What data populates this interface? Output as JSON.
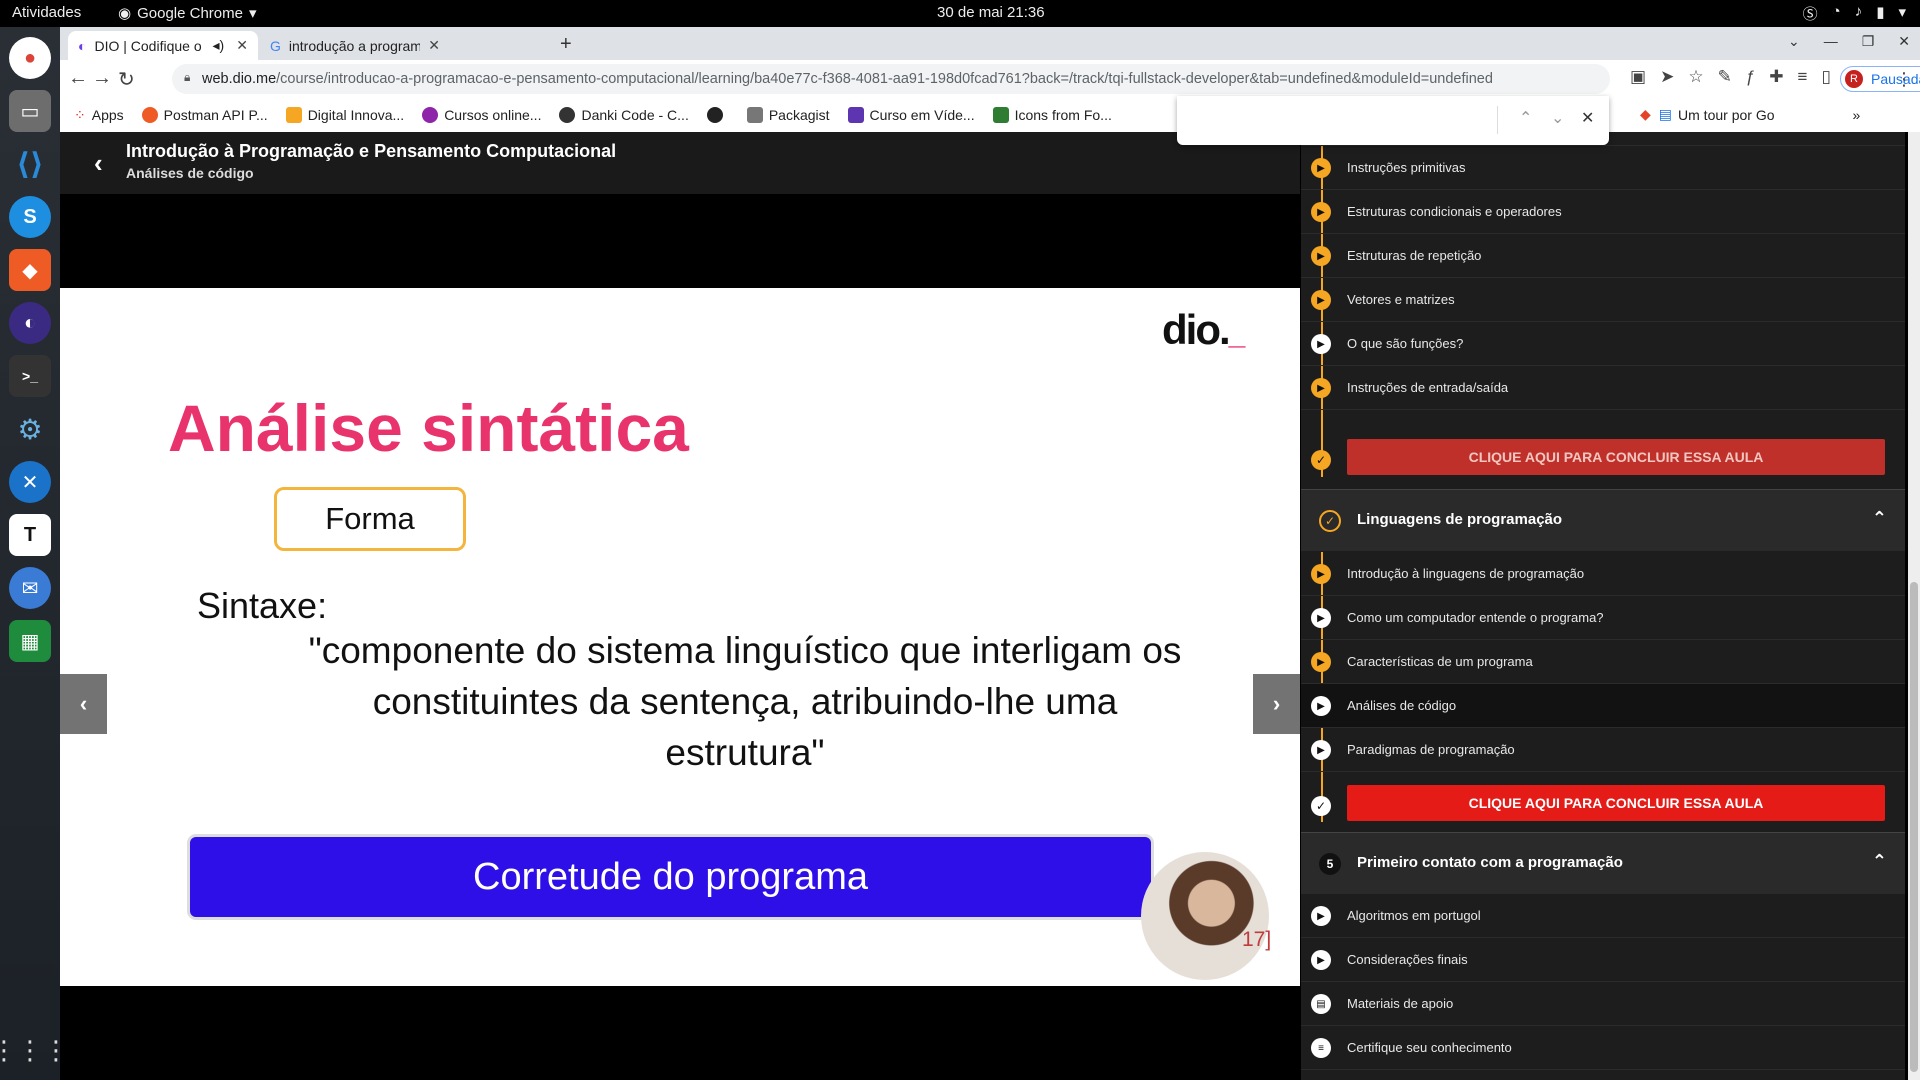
{
  "topbar": {
    "activities": "Atividades",
    "app": "Google Chrome",
    "clock": "30 de mai  21:36"
  },
  "tabs": [
    {
      "title": "DIO | Codifique o seu f"
    },
    {
      "title": "introdução a programaçã"
    }
  ],
  "address": {
    "domain": "web.dio.me",
    "path": "/course/introducao-a-programacao-e-pensamento-computacional/learning/ba40e77c-f368-4081-aa91-198d0fcad761?back=/track/tqi-fullstack-developer&tab=undefined&moduleId=undefined"
  },
  "profile": {
    "initial": "R",
    "label": "Pausada"
  },
  "bookmarks": [
    {
      "label": "Apps",
      "color": "#d93025"
    },
    {
      "label": "Postman API P...",
      "color": "#ef5b25"
    },
    {
      "label": "Digital Innova...",
      "color": "#f5a623"
    },
    {
      "label": "Cursos online...",
      "color": "#8e24aa"
    },
    {
      "label": "Danki Code - C...",
      "color": "#333333"
    },
    {
      "label": "",
      "color": "#222222"
    },
    {
      "label": "Packagist",
      "color": "#777777"
    },
    {
      "label": "Curso em Víde...",
      "color": "#5e35b1"
    },
    {
      "label": "Icons from Fo...",
      "color": "#2e7d32"
    }
  ],
  "bookmarks_right": {
    "label": "Um tour por Go"
  },
  "course": {
    "title": "Introdução à Programação e Pensamento Computacional",
    "subtitle": "Análises de código"
  },
  "slide": {
    "logo": "dio.",
    "logo_dash": "_",
    "title": "Análise sintática",
    "forma": "Forma",
    "sintaxe": "Sintaxe:",
    "quote_line1": "\"componente do sistema linguístico que interligam os",
    "quote_line2": "constituintes da sentença, atribuindo-lhe uma",
    "quote_line3": "estrutura\"",
    "banner": "Corretude do programa",
    "page": "17]"
  },
  "sidebar": {
    "group1": [
      {
        "label": "Instruções primitivas"
      },
      {
        "label": "Estruturas condicionais e operadores"
      },
      {
        "label": "Estruturas de repetição"
      },
      {
        "label": "Vetores e matrizes"
      },
      {
        "label": "O que são funções?"
      },
      {
        "label": "Instruções de entrada/saída"
      }
    ],
    "cta1": "CLIQUE AQUI PARA CONCLUIR ESSA AULA",
    "module2": "Linguagens de programação",
    "group2": [
      {
        "label": "Introdução à linguagens de programação"
      },
      {
        "label": "Como um computador entende o programa?"
      },
      {
        "label": "Características de um programa"
      },
      {
        "label": "Análises de código"
      },
      {
        "label": "Paradigmas de programação"
      }
    ],
    "cta2": "CLIQUE AQUI PARA CONCLUIR ESSA AULA",
    "module3_num": "5",
    "module3": "Primeiro contato com a programação",
    "group3": [
      {
        "label": "Algoritmos em portugol"
      },
      {
        "label": "Considerações finais"
      },
      {
        "label": "Materiais de apoio"
      },
      {
        "label": "Certifique seu conhecimento"
      }
    ]
  },
  "colors": {
    "accent": "#f5a623",
    "cta_dark": "#c0302a",
    "cta_bright": "#e41b17",
    "brand_pink": "#e8336d",
    "banner": "#2e0fe8"
  }
}
